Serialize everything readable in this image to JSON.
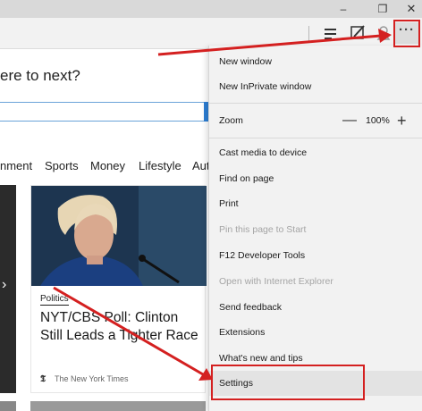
{
  "window": {
    "controls": {
      "minimize": "–",
      "restore": "❐",
      "close": "✕"
    }
  },
  "toolbar": {
    "icons": [
      "hub-icon",
      "web-note-icon",
      "share-icon"
    ],
    "more_label": "···"
  },
  "page": {
    "question": "ere to next?",
    "search": {
      "value": "",
      "placeholder": ""
    },
    "nav": [
      "nment",
      "Sports",
      "Money",
      "Lifestyle",
      "Auto"
    ],
    "carousel_arrow": "›",
    "news": {
      "category": "Politics",
      "title": "NYT/CBS Poll: Clinton Still Leads a Tighter Race",
      "source_icon": "𝕿",
      "source": "The New York Times"
    }
  },
  "menu": {
    "items": [
      {
        "label": "New window",
        "enabled": true
      },
      {
        "label": "New InPrivate window",
        "enabled": true
      },
      {
        "label": "Cast media to device",
        "enabled": true
      },
      {
        "label": "Find on page",
        "enabled": true
      },
      {
        "label": "Print",
        "enabled": true
      },
      {
        "label": "Pin this page to Start",
        "enabled": false
      },
      {
        "label": "F12 Developer Tools",
        "enabled": true
      },
      {
        "label": "Open with Internet Explorer",
        "enabled": false
      },
      {
        "label": "Send feedback",
        "enabled": true
      },
      {
        "label": "Extensions",
        "enabled": true
      },
      {
        "label": "What's new and tips",
        "enabled": true
      },
      {
        "label": "Settings",
        "enabled": true
      }
    ],
    "zoom": {
      "label": "Zoom",
      "minus": "—",
      "value": "100%",
      "plus": "+"
    }
  },
  "colors": {
    "annotation": "#d42020",
    "accent": "#2d7fd4",
    "menu_background": "#f2f2f2",
    "disabled_text": "#a5a5a5"
  }
}
